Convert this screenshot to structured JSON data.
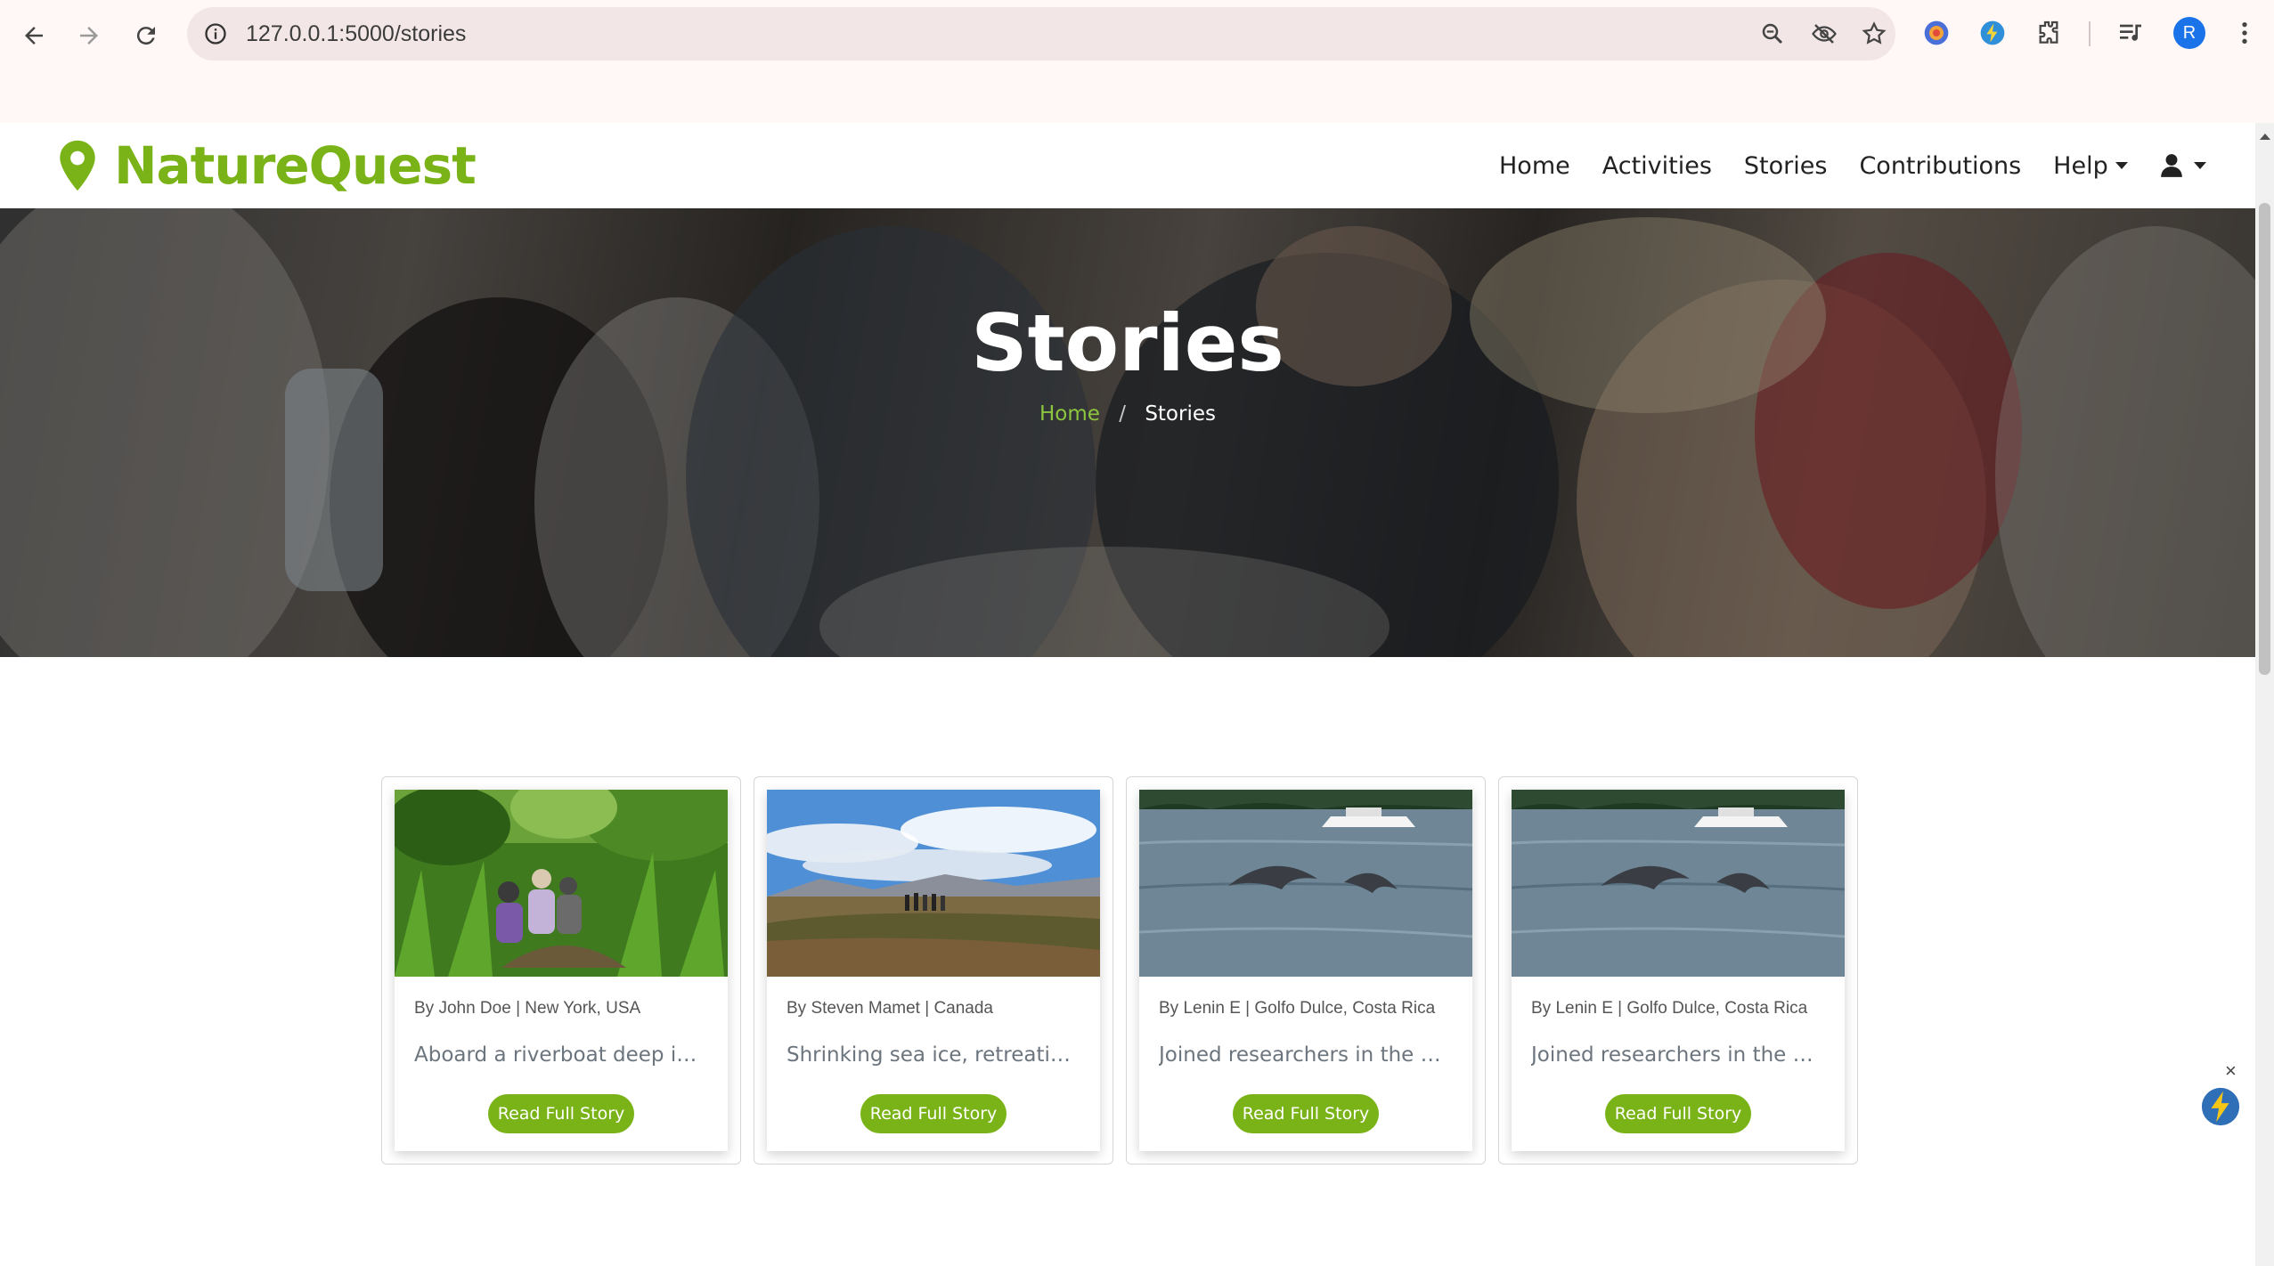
{
  "browser": {
    "url": "127.0.0.1:5000/stories",
    "profile_initial": "R",
    "icons": [
      "back-arrow-icon",
      "forward-arrow-icon",
      "reload-icon",
      "site-info-icon",
      "zoom-icon",
      "eye-off-icon",
      "star-icon",
      "extension-color-icon",
      "extension-bolt-icon",
      "puzzle-icon",
      "reading-list-icon",
      "more-vert-icon"
    ]
  },
  "site": {
    "brand": "NatureQuest",
    "brand_color": "#7ab317",
    "nav": {
      "home": "Home",
      "activities": "Activities",
      "stories": "Stories",
      "contributions": "Contributions",
      "help": "Help"
    }
  },
  "hero": {
    "title": "Stories",
    "breadcrumb_home": "Home",
    "breadcrumb_sep": "/",
    "breadcrumb_current": "Stories"
  },
  "cards": [
    {
      "meta": "By John Doe | New York, USA",
      "excerpt": "Aboard a riverboat deep in the ...",
      "button": "Read Full Story",
      "image": "riverboat-jungle"
    },
    {
      "meta": "By Steven Mamet | Canada",
      "excerpt": "Shrinking sea ice, retreating gla...",
      "button": "Read Full Story",
      "image": "tundra-hikers"
    },
    {
      "meta": "By Lenin E | Golfo Dulce, Costa Rica",
      "excerpt": "Joined researchers in the pristi...",
      "button": "Read Full Story",
      "image": "dolphins-boat"
    },
    {
      "meta": "By Lenin E | Golfo Dulce, Costa Rica",
      "excerpt": "Joined researchers in the pristi...",
      "button": "Read Full Story",
      "image": "dolphins-boat"
    }
  ],
  "widget": {
    "close": "×"
  }
}
